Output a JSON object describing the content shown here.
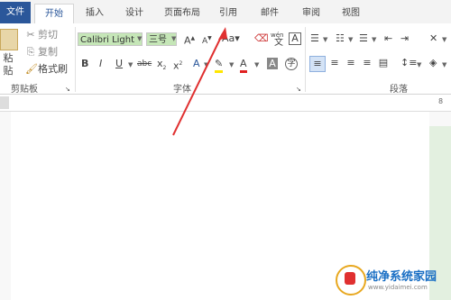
{
  "tabs": [
    "文件",
    "开始",
    "插入",
    "设计",
    "页面布局",
    "引用",
    "邮件",
    "审阅",
    "视图"
  ],
  "clipboard": {
    "paste": "粘贴",
    "cut": "剪切",
    "copy": "复制",
    "format_painter": "格式刷",
    "group_label": "剪贴板"
  },
  "font": {
    "name": "Calibri Light",
    "size": "三号",
    "group_label": "字体",
    "wen": "wén"
  },
  "paragraph": {
    "group_label": "段落"
  },
  "ruler": {
    "mark": "8"
  },
  "watermark": {
    "title": "纯净系统家园",
    "url": "www.yidaimei.com"
  },
  "colors": {
    "accent": "#2b579a",
    "highlight": "#c5e6b7",
    "arrow": "#e03030"
  }
}
